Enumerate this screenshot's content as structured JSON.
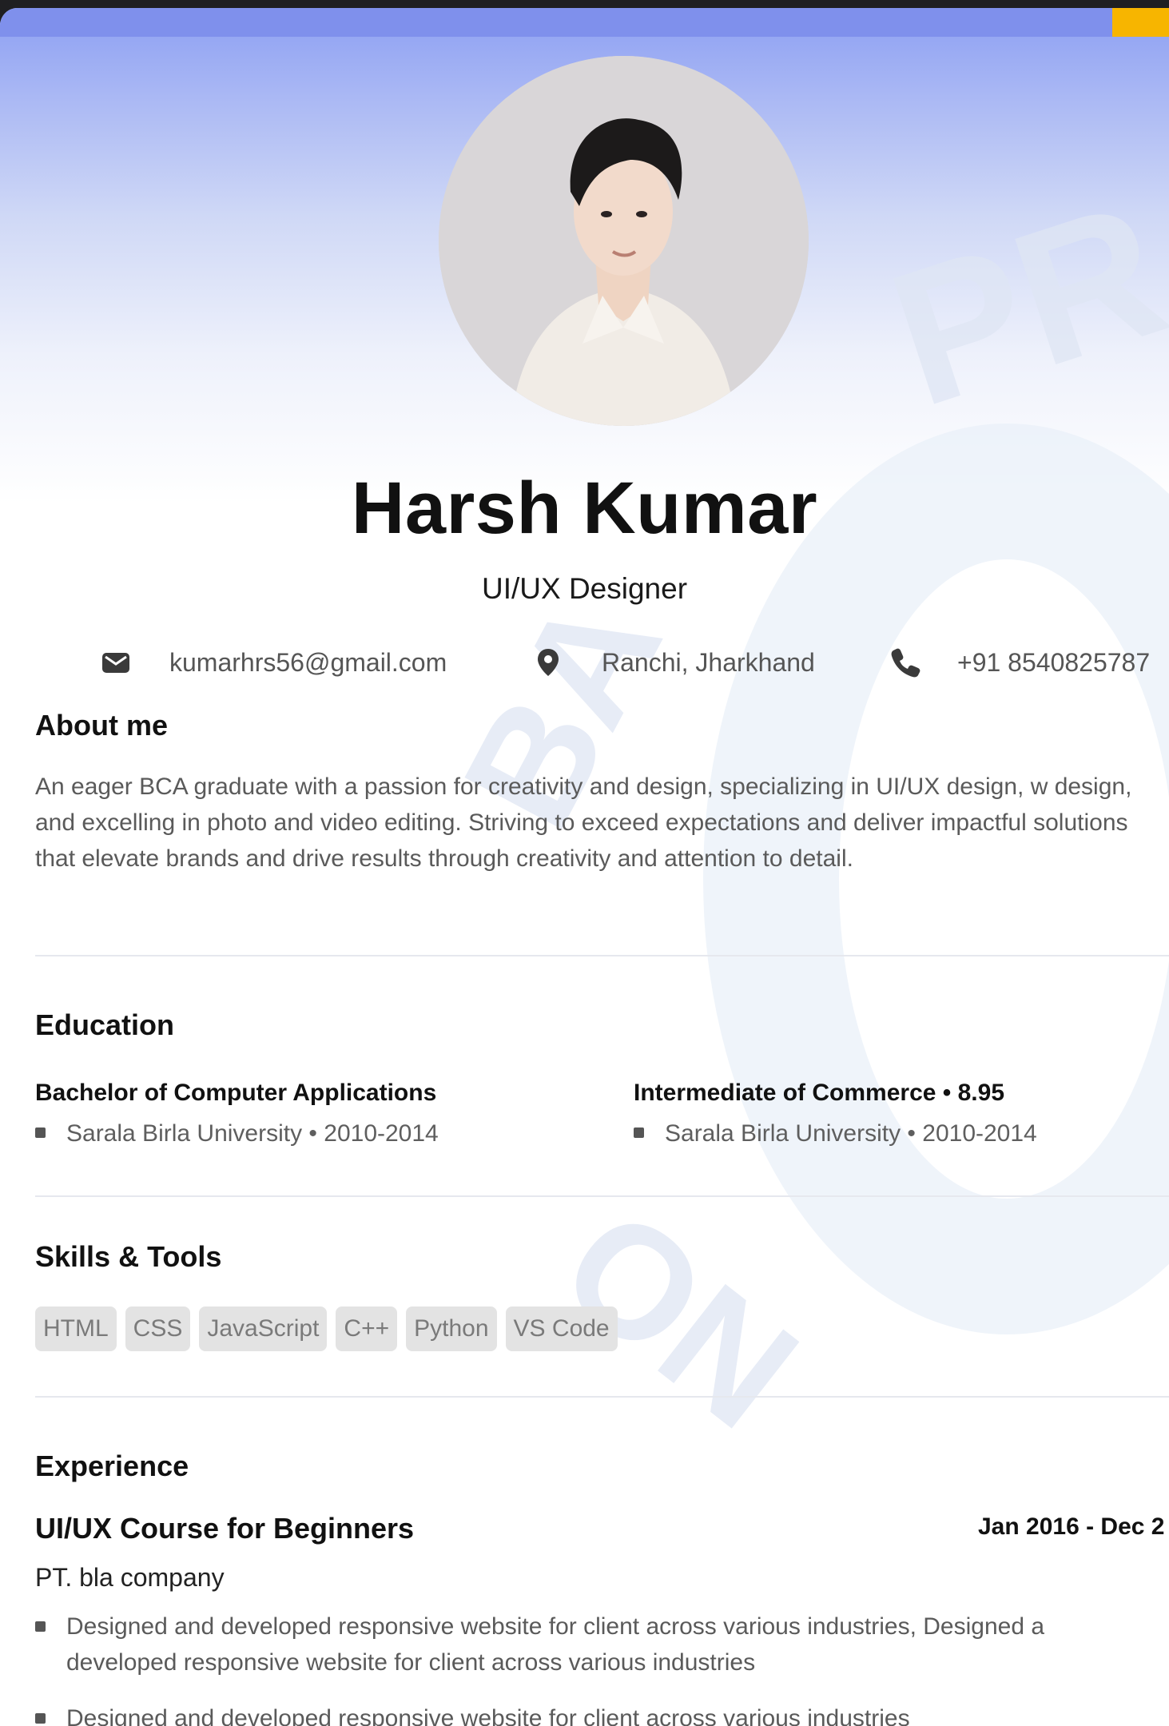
{
  "profile": {
    "name": "Harsh Kumar",
    "role": "UI/UX Designer"
  },
  "contact": {
    "email": "kumarhrs56@gmail.com",
    "location": "Ranchi, Jharkhand",
    "phone": "+91 8540825787"
  },
  "about": {
    "heading": "About me",
    "text": "An eager BCA graduate with a passion for creativity and design, specializing in UI/UX design, w design, and excelling in photo and video editing. Striving to exceed expectations and deliver impactful solutions that elevate brands and drive results through creativity and attention to detail."
  },
  "education": {
    "heading": "Education",
    "items": [
      {
        "title": "Bachelor of Computer Applications",
        "detail": "Sarala Birla University • 2010-2014"
      },
      {
        "title": "Intermediate of Commerce • 8.95",
        "detail": "Sarala Birla University • 2010-2014"
      }
    ]
  },
  "skills": {
    "heading": "Skills & Tools",
    "tags": [
      "HTML",
      "CSS",
      "JavaScript",
      "C++",
      "Python",
      "VS Code"
    ]
  },
  "experience": {
    "heading": "Experience",
    "items": [
      {
        "title": "UI/UX Course for Beginners",
        "dates": "Jan 2016 - Dec 2",
        "company": "PT. bla company",
        "bullets": [
          "Designed and developed responsive website for client across various industries, Designed a\ndeveloped responsive website for client across various industries",
          "Designed and developed responsive website for client across various industries"
        ]
      }
    ]
  },
  "watermark": {
    "text_1": "PR",
    "text_2": "BA",
    "text_3": "ON"
  },
  "colors": {
    "hero_top": "#8c9ff2",
    "accent_tab": "#f7b500",
    "tag_bg": "#e3e3e3",
    "divider": "#e6e8ee"
  },
  "icons": [
    "mail-icon",
    "location-pin-icon",
    "phone-icon"
  ]
}
